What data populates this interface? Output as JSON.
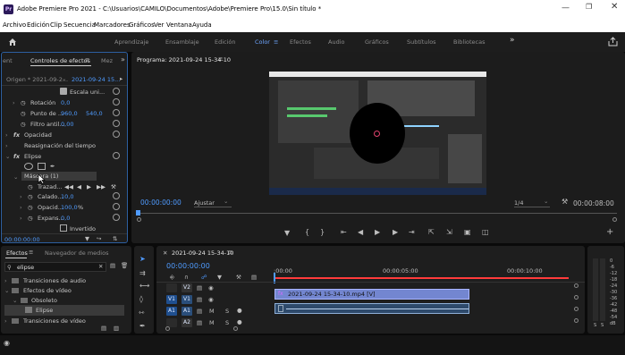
{
  "window": {
    "app_logo": "Pr",
    "title": "Adobe Premiere Pro 2021 - C:\\Usuarios\\CAMILO\\Documentos\\Adobe\\Premiere Pro\\15.0\\Sin título *",
    "minimize_icon": "minimize-icon",
    "maximize_icon": "restore-icon",
    "close_icon": "close-icon"
  },
  "menu": [
    "Archivo",
    "Edición",
    "Clip",
    "Secuencia",
    "Marcadores",
    "Gráficos",
    "Ver",
    "Ventana",
    "Ayuda"
  ],
  "workspaces": {
    "items": [
      "Aprendizaje",
      "Ensamblaje",
      "Edición",
      "Color",
      "Efectos",
      "Audio",
      "Gráficos",
      "Subtítulos",
      "Bibliotecas"
    ],
    "active": "Color",
    "more": "»"
  },
  "effect_controls": {
    "tab_left": "ent",
    "tab_active": "Controles de efectos",
    "tab_right": "Mez",
    "origin": "Origen * 2021-09-2...",
    "sequence": "2021-09-24 15...",
    "scale_uniform": "Escala uni...",
    "rotation_label": "Rotación",
    "rotation_value": "0,0",
    "anchor_label": "Punto de ...",
    "anchor_x": "960,0",
    "anchor_y": "540,0",
    "flicker_label": "Filtro antil...",
    "flicker_value": "0,00",
    "opacity_label": "Opacidad",
    "remap_label": "Reasignación del tiempo",
    "ellipse_label": "Elipse",
    "mask_label": "Máscara (1)",
    "mask_path_label": "Trazad...",
    "feather_label": "Calado...",
    "feather_value": "10,0",
    "opacity2_label": "Opacid...",
    "opacity2_value": "100,0",
    "opacity2_unit": "%",
    "expansion_label": "Expans...",
    "expansion_value": "0,0",
    "inverted_label": "Invertido",
    "timecode": "00:00:00:00"
  },
  "program": {
    "tab": "Programa: 2021-09-24 15-34-10",
    "timecode_left": "00:00:00:00",
    "fit": "Ajustar",
    "resolution": "1/4",
    "timecode_right": "00:00:08:00"
  },
  "effects": {
    "tab_active": "Efectos",
    "tab_other": "Navegador de medios",
    "search_value": "elipse",
    "tree": [
      "Transiciones de audio",
      "Efectos de vídeo",
      "Obsoleto",
      "Elipse",
      "Transiciones de vídeo"
    ]
  },
  "timeline": {
    "tab": "2021-09-24 15-34-10",
    "timecode": "00:00:00:00",
    "ruler": [
      ":00:00",
      "00:00:05:00",
      "00:00:10:00"
    ],
    "tracks": [
      "V2",
      "V1",
      "A1",
      "A2"
    ],
    "src_v": "V1",
    "src_a": "A1",
    "clip_label": "2021-09-24 15-34-10.mp4 [V]"
  },
  "audio_meter": {
    "scale": [
      "0",
      "-6",
      "-12",
      "-18",
      "-24",
      "-30",
      "-36",
      "-42",
      "-48",
      "-54",
      "dB"
    ],
    "channels": [
      "S",
      "S"
    ]
  },
  "colors": {
    "accent": "#4f9bff",
    "clip_video": "#6a7fc8",
    "clip_audio": "#2e4a6b",
    "playhead": "#ff3b3b"
  }
}
